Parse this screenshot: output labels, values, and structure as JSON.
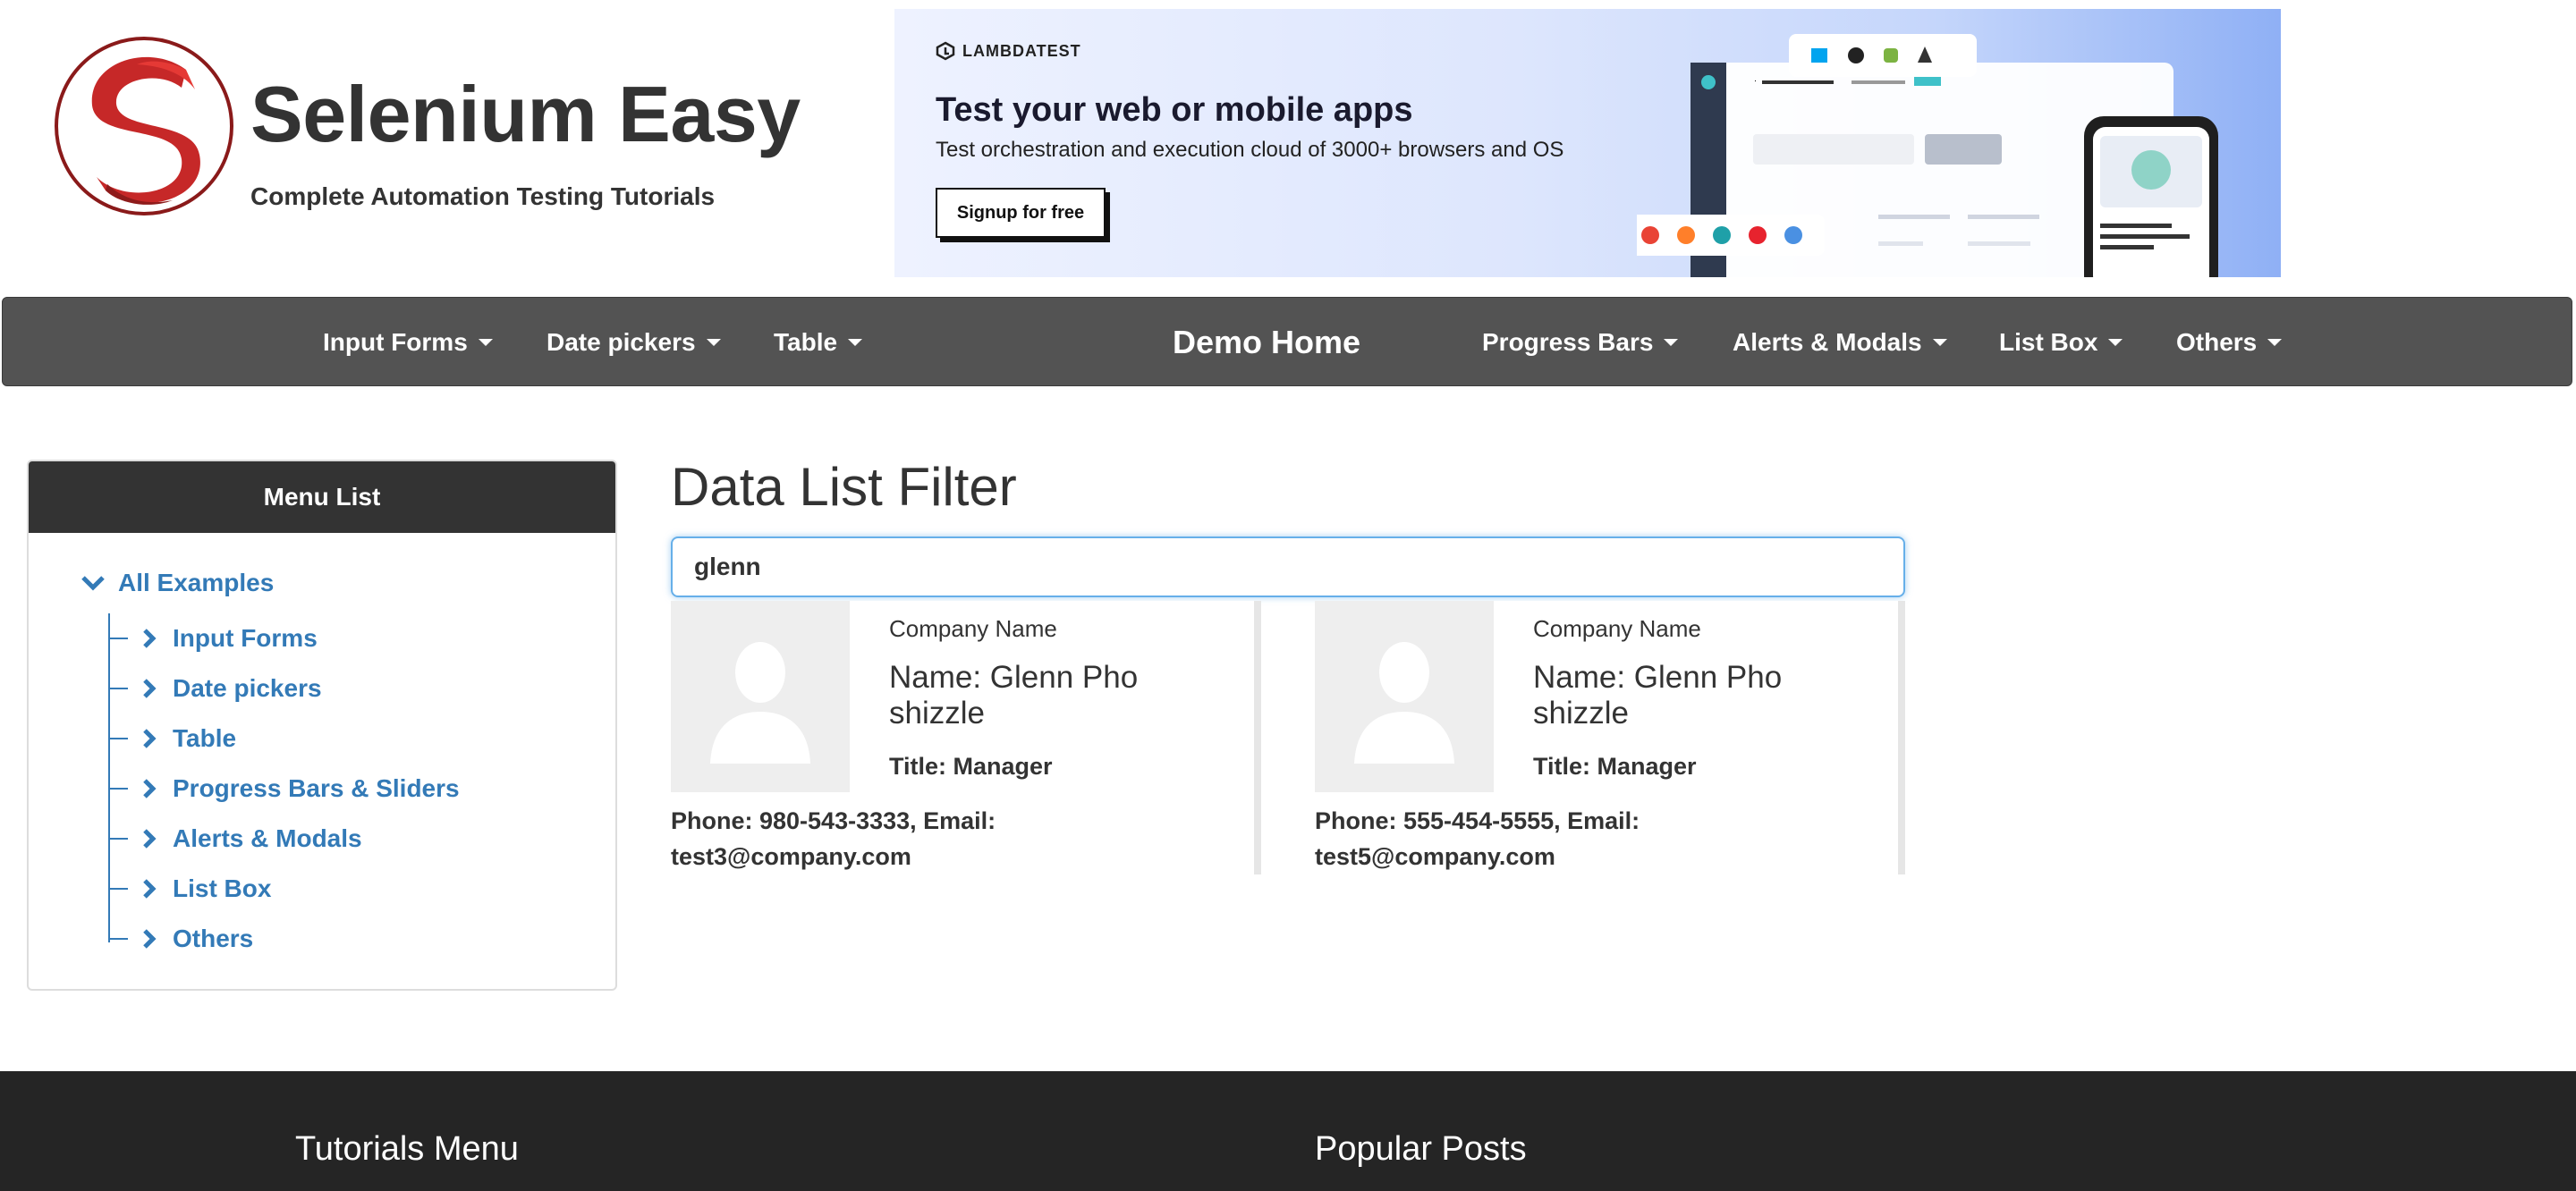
{
  "header": {
    "site_title": "Selenium Easy",
    "tagline": "Complete Automation Testing Tutorials",
    "brand_color": "#c62828"
  },
  "ad": {
    "brand": "LAMBDATEST",
    "headline": "Test your web or mobile apps",
    "subtext": "Test orchestration and execution cloud of 3000+ browsers and OS",
    "cta_label": "Signup for free"
  },
  "navbar": {
    "left_items": [
      "Input Forms",
      "Date pickers",
      "Table"
    ],
    "home": "Demo Home",
    "right_items": [
      "Progress Bars",
      "Alerts & Modals",
      "List Box",
      "Others"
    ]
  },
  "sidebar": {
    "title": "Menu List",
    "root": "All Examples",
    "items": [
      "Input Forms",
      "Date pickers",
      "Table",
      "Progress Bars & Sliders",
      "Alerts & Modals",
      "List Box",
      "Others"
    ]
  },
  "main": {
    "title": "Data List Filter",
    "search_value": "glenn",
    "cards": [
      {
        "company": "Company Name",
        "name": "Name: Glenn Pho shizzle",
        "title": "Title: Manager",
        "contact": "Phone: 980-543-3333, Email: test3@company.com"
      },
      {
        "company": "Company Name",
        "name": "Name: Glenn Pho shizzle",
        "title": "Title: Manager",
        "contact": "Phone: 555-454-5555, Email: test5@company.com"
      }
    ]
  },
  "footer": {
    "col1": "Tutorials Menu",
    "col2": "Popular Posts"
  },
  "colors": {
    "navbar_bg": "#535353",
    "link": "#337ab7",
    "sidebar_head_bg": "#333333",
    "footer_bg": "#252525",
    "input_focus": "#66afe9"
  }
}
